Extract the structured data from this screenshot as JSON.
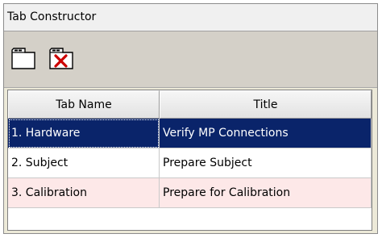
{
  "window": {
    "title": "Tab Constructor"
  },
  "toolbar": {
    "buttons": [
      {
        "icon": "new-tab-icon"
      },
      {
        "icon": "delete-tab-icon"
      }
    ]
  },
  "grid": {
    "columns": [
      "Tab Name",
      "Title"
    ],
    "rows": [
      {
        "tab_name": "1. Hardware",
        "title": "Verify MP Connections",
        "selected": true
      },
      {
        "tab_name": "2. Subject",
        "title": "Prepare Subject",
        "selected": false
      },
      {
        "tab_name": "3. Calibration",
        "title": "Prepare for Calibration",
        "selected": false
      }
    ]
  },
  "colors": {
    "selection": "#0a246a",
    "alt_row": "#fde8e8",
    "toolbar_bg": "#d4d0c8",
    "delete_x": "#cc0000"
  }
}
